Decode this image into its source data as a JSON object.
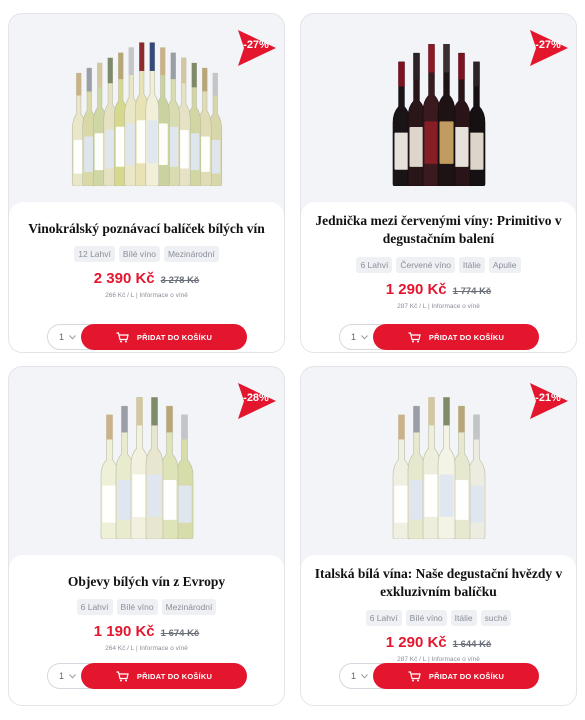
{
  "products": [
    {
      "title": "Vinokrálský poznávací balíček bílých vín",
      "discount": "-27%",
      "tags": [
        "12 Lahví",
        "Bílé víno",
        "Mezinárodní"
      ],
      "price": "2 390 Kč",
      "old_price": "3 278 Kč",
      "unit_price": "266 Kč / L",
      "info_link": "Informace o víně",
      "qty": "1",
      "add_label": "PŘIDAT DO KOŠÍKU",
      "bottle_colors": [
        "#e9e6c9",
        "#d8d9a6",
        "#cfd7a4",
        "#e4e2c2",
        "#d6d98d",
        "#eae7c7",
        "#e8e3b4",
        "#f1efd8",
        "#cad2a0",
        "#d9dcb0",
        "#e6e2c6",
        "#d2d6a2",
        "#e0dcb6",
        "#d8d7aa"
      ]
    },
    {
      "title": "Jednička mezi červenými víny: Primitivo v degustačním balení",
      "discount": "-27%",
      "tags": [
        "6 Lahví",
        "Červené víno",
        "Itálie",
        "Apulie"
      ],
      "price": "1 290 Kč",
      "old_price": "1 774 Kč",
      "unit_price": "287 Kč / L",
      "info_link": "Informace o víně",
      "qty": "1",
      "add_label": "PŘIDAT DO KOŠÍKU",
      "bottle_colors": [
        "#1b1416",
        "#2a1519",
        "#3a1a1e",
        "#1e1214",
        "#2b1418",
        "#151012"
      ]
    },
    {
      "title": "Objevy bílých vín z Evropy",
      "discount": "-28%",
      "tags": [
        "6 Lahví",
        "Bílé víno",
        "Mezinárodní"
      ],
      "price": "1 190 Kč",
      "old_price": "1 674 Kč",
      "unit_price": "264 Kč / L",
      "info_link": "Informace o víně",
      "qty": "1",
      "add_label": "PŘIDAT DO KOŠÍKU",
      "bottle_colors": [
        "#eef0d8",
        "#e9ebce",
        "#f2f1e0",
        "#e8e6cf",
        "#dfe3b8",
        "#d6dcaa"
      ]
    },
    {
      "title": "Italská bílá vína: Naše degustační hvězdy v exkluzivním balíčku",
      "discount": "-21%",
      "tags": [
        "6 Lahví",
        "Bílé víno",
        "Itálie",
        "suché"
      ],
      "price": "1 290 Kč",
      "old_price": "1 644 Kč",
      "unit_price": "287 Kč / L",
      "info_link": "Informace o víně",
      "qty": "1",
      "add_label": "PŘIDAT DO KOŠÍKU",
      "bottle_colors": [
        "#f0f0e2",
        "#e7e9cf",
        "#eeeedc",
        "#f3f3e6",
        "#e6e8d0",
        "#ecede0"
      ]
    }
  ],
  "colors": {
    "accent": "#e3162e",
    "card_bg": "#f3f4f7"
  }
}
